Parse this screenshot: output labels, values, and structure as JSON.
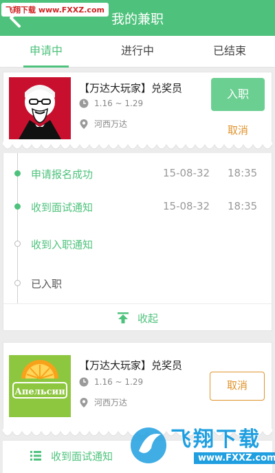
{
  "header": {
    "title": "我的兼职",
    "watermark": "飞翔下载 www.FXXZ.com"
  },
  "tabs": [
    {
      "label": "申请中",
      "active": true
    },
    {
      "label": "进行中",
      "active": false
    },
    {
      "label": "已结束",
      "active": false
    }
  ],
  "jobs": [
    {
      "logo_icon": "kfc-colonel-logo",
      "title": "【万达大玩家】兑奖员",
      "dates": "1.16 ~ 1.29",
      "location": "河西万达",
      "primary_button": "入职",
      "secondary_button": "取消"
    },
    {
      "logo_icon": "orange-slice-logo",
      "logo_text": "Апельсин",
      "title": "【万达大玩家】兑奖员",
      "dates": "1.16 ~ 1.29",
      "location": "河西万达",
      "secondary_button": "取消"
    }
  ],
  "timeline": [
    {
      "label": "申请报名成功",
      "date": "15-08-32",
      "time": "18:35",
      "status": "done"
    },
    {
      "label": "收到面试通知",
      "date": "15-08-32",
      "time": "18:35",
      "status": "done"
    },
    {
      "label": "收到入职通知",
      "date": "",
      "time": "",
      "status": "todo"
    },
    {
      "label": "已入职",
      "date": "",
      "time": "",
      "status": "todo"
    }
  ],
  "collapse_label": "收起",
  "bottom_status": "收到面试通知",
  "bottom_watermark": {
    "title": "飞翔下载",
    "url": "www.FXXZ.com"
  },
  "colors": {
    "accent": "#4ec27c",
    "cancel": "#e0922a"
  }
}
